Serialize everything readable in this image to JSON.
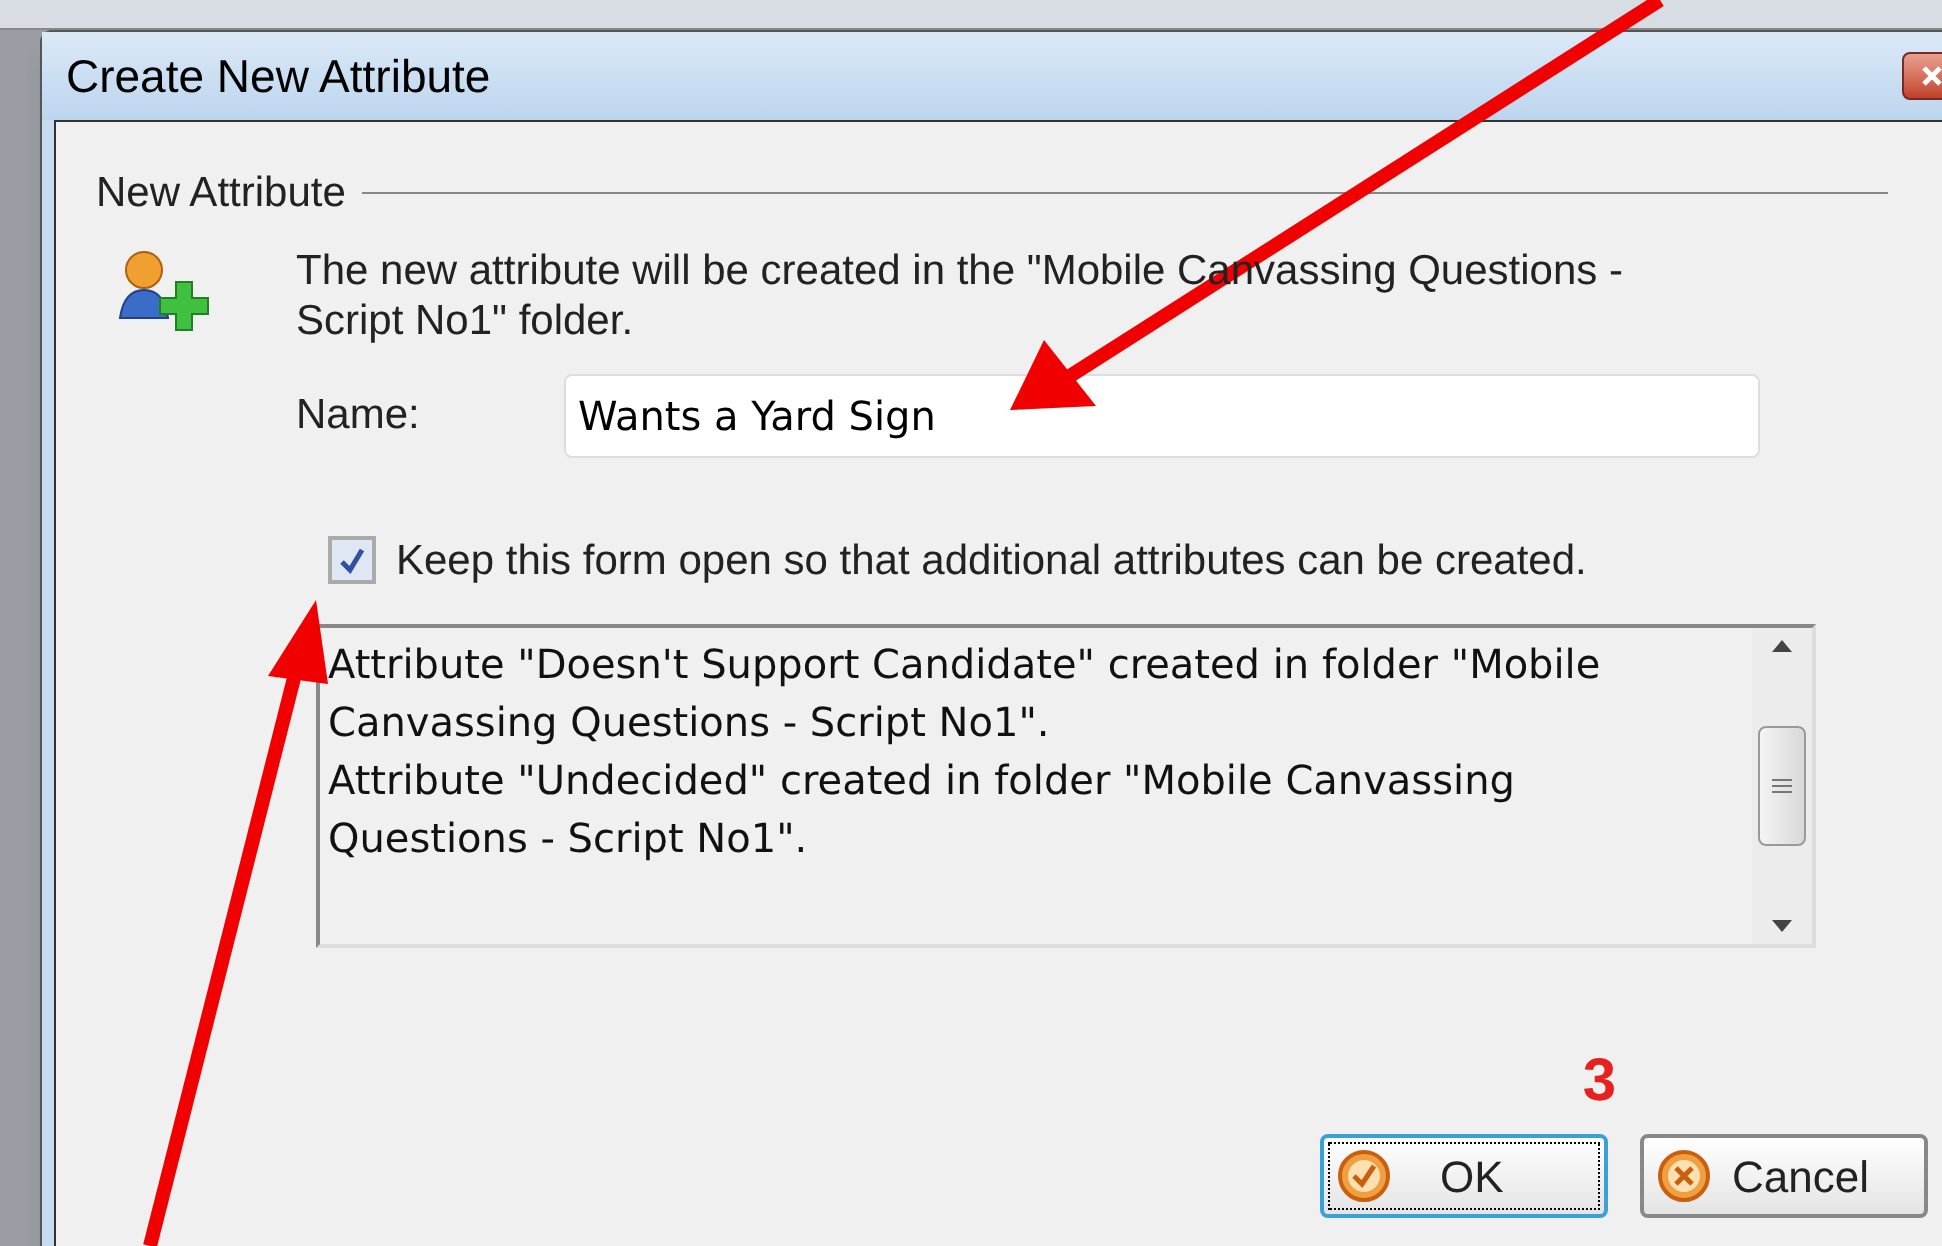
{
  "window": {
    "title": "Create New Attribute"
  },
  "group": {
    "title": "New Attribute"
  },
  "info": "The new attribute will be created in the \"Mobile Canvassing Questions - Script No1\" folder.",
  "name_field": {
    "label": "Name:",
    "value": "Wants a Yard Sign"
  },
  "keep_open": {
    "label": "Keep this form open so that additional attributes can be created.",
    "checked": true
  },
  "log": {
    "lines": [
      "Attribute \"Doesn't Support Candidate\" created in folder \"Mobile Canvassing Questions - Script No1\".",
      "Attribute \"Undecided\" created in folder \"Mobile Canvassing Questions - Script No1\"."
    ]
  },
  "annotation": {
    "step": "3"
  },
  "buttons": [
    {
      "label": "OK",
      "kind": "ok",
      "focused": true
    },
    {
      "label": "Cancel",
      "kind": "cancel",
      "focused": false
    }
  ]
}
